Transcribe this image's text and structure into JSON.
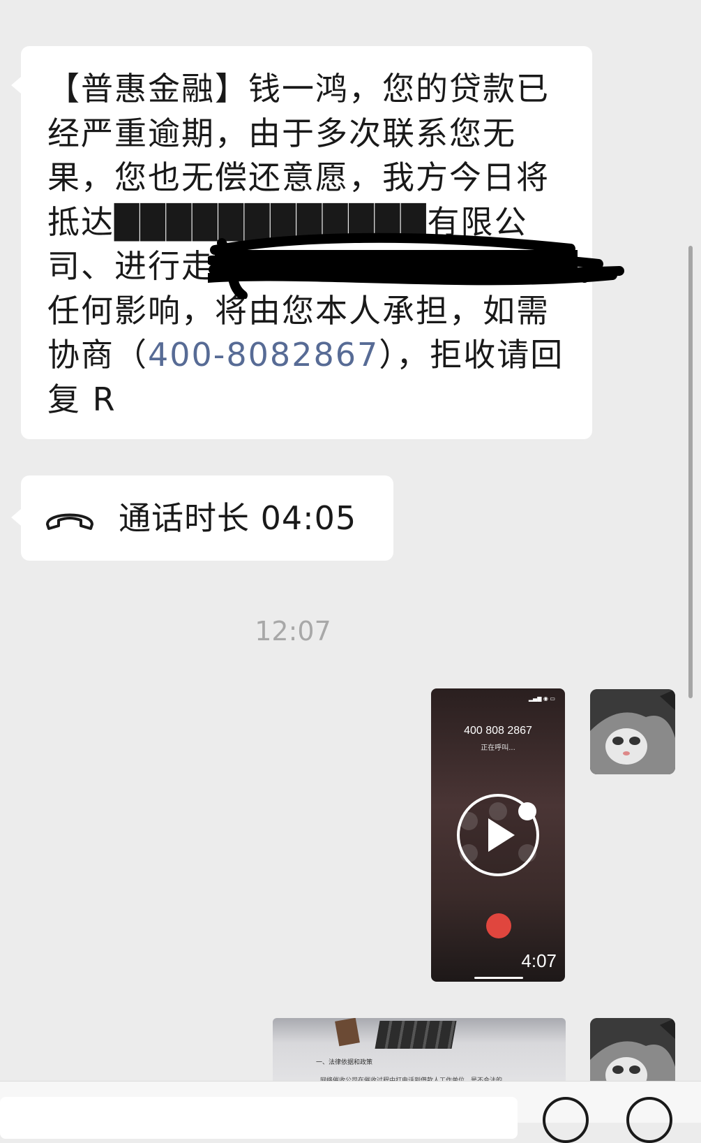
{
  "messages": {
    "sms_text_before_link": "【普惠金融】钱一鸿，您的贷款已经严重逾期，由于多次联系您无果，您也无偿还意愿，我方今日将抵达████████████有限公司、进行走访了解，如果对您造成任何影响，将由您本人承担，如需协商（",
    "sms_phone_link": "400-8082867",
    "sms_text_after_link": "），拒收请回复 R",
    "call_record": "通话时长 04:05",
    "timestamp": "12:07"
  },
  "video_message": {
    "phone_number": "400 808 2867",
    "call_status": "正在呼叫...",
    "duration": "4:07"
  },
  "image_message": {
    "doc_heading": "一、法律依据和政策",
    "doc_line": "网络催收公司在催收过程中打电话到借款人工作单位，是不合法的。"
  },
  "icons": {
    "call": "phone-hangup-icon",
    "play": "play-icon",
    "emoji": "emoji-icon",
    "plus": "plus-icon"
  },
  "colors": {
    "background": "#ececec",
    "bubble": "#ffffff",
    "link": "#576b95",
    "timestamp": "#a8a8a8",
    "hangup": "#e0463e"
  }
}
